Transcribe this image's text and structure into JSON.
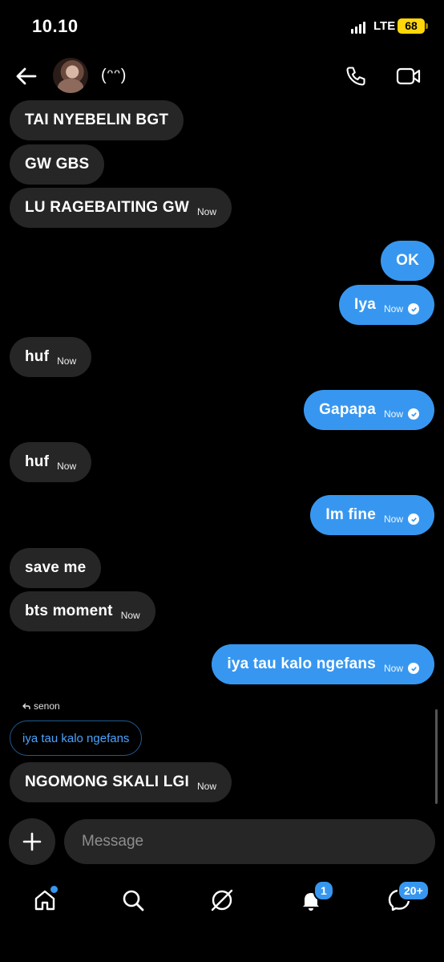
{
  "status_bar": {
    "time": "10.10",
    "network": "LTE",
    "battery": "68"
  },
  "header": {
    "username": "(ᵔᵔ)",
    "icons": [
      "back-arrow-icon",
      "phone-icon",
      "video-camera-icon"
    ]
  },
  "messages": [
    {
      "side": "in",
      "text": "TAI NYEBELIN BGT",
      "time": ""
    },
    {
      "side": "in",
      "text": "GW GBS",
      "time": ""
    },
    {
      "side": "in",
      "text": "LU RAGEBAITING GW",
      "time": "Now"
    },
    {
      "side": "out",
      "text": "OK",
      "time": ""
    },
    {
      "side": "out",
      "text": "Iya",
      "time": "Now"
    },
    {
      "side": "in",
      "text": "huf",
      "time": "Now"
    },
    {
      "side": "out",
      "text": "Gapapa",
      "time": "Now"
    },
    {
      "side": "in",
      "text": "huf",
      "time": "Now"
    },
    {
      "side": "out",
      "text": "Im fine",
      "time": "Now"
    },
    {
      "side": "in",
      "text": "save me",
      "time": ""
    },
    {
      "side": "in",
      "text": "bts moment",
      "time": "Now"
    },
    {
      "side": "out",
      "text": "iya tau kalo ngefans",
      "time": "Now"
    },
    {
      "side": "in",
      "text": "NGOMONG SKALI LGI",
      "time": "Now"
    }
  ],
  "reply": {
    "label": "senon",
    "quoted": "iya tau kalo ngefans"
  },
  "composer": {
    "placeholder": "Message"
  },
  "tabbar": {
    "notifications_badge": "1",
    "messages_badge": "20+"
  },
  "colors": {
    "outgoing": "#3797f0",
    "incoming": "#262626",
    "battery": "#ffd60a"
  }
}
